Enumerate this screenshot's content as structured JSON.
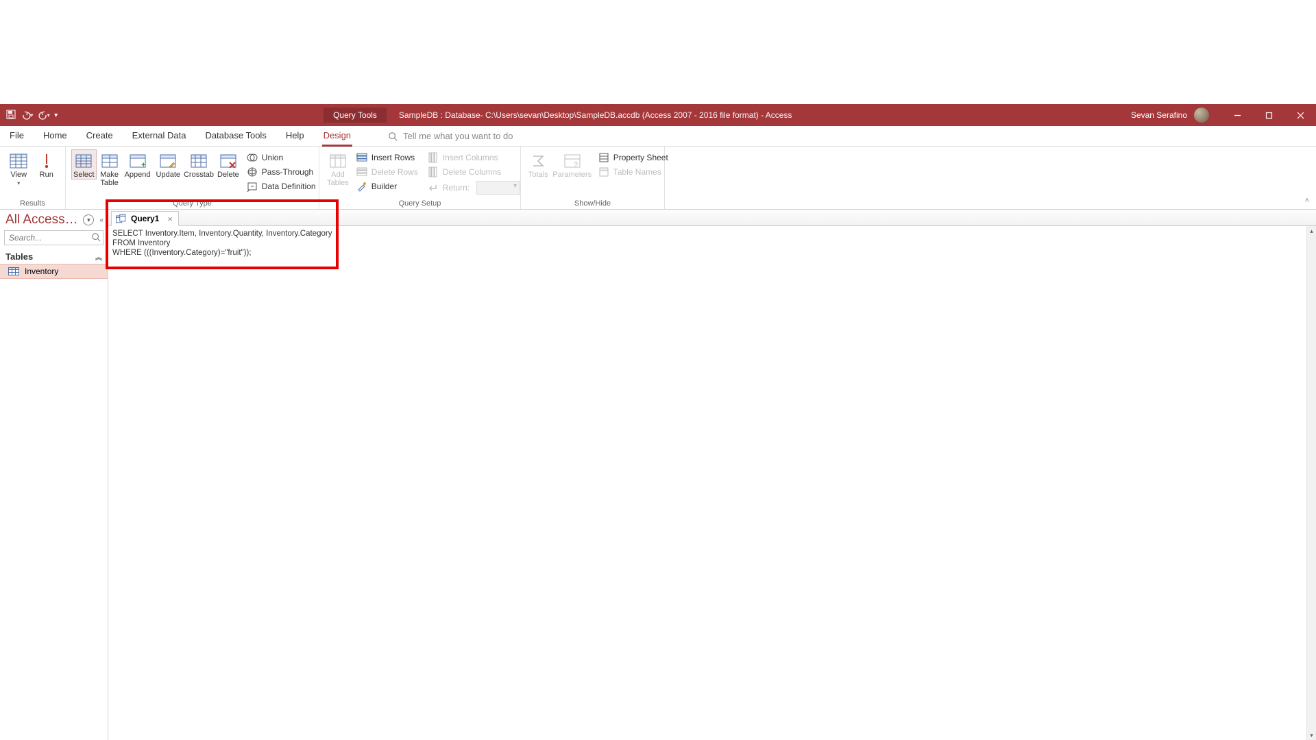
{
  "titlebar": {
    "contextual_tab": "Query Tools",
    "document_title": "SampleDB : Database- C:\\Users\\sevan\\Desktop\\SampleDB.accdb (Access 2007 - 2016 file format)  -  Access",
    "user_name": "Sevan Serafino"
  },
  "menubar": {
    "tabs": [
      "File",
      "Home",
      "Create",
      "External Data",
      "Database Tools",
      "Help",
      "Design"
    ],
    "active_tab_index": 6,
    "search_placeholder": "Tell me what you want to do"
  },
  "ribbon": {
    "groups": {
      "results": {
        "label": "Results",
        "buttons": {
          "view": "View",
          "run": "Run"
        }
      },
      "query_type": {
        "label": "Query Type",
        "buttons": {
          "select": "Select",
          "make_table_l1": "Make",
          "make_table_l2": "Table",
          "append": "Append",
          "update": "Update",
          "crosstab": "Crosstab",
          "delete": "Delete",
          "union": "Union",
          "pass_through": "Pass-Through",
          "data_definition": "Data Definition"
        }
      },
      "query_setup": {
        "label": "Query Setup",
        "buttons": {
          "add_tables_l1": "Add",
          "add_tables_l2": "Tables",
          "insert_rows": "Insert Rows",
          "delete_rows": "Delete Rows",
          "builder": "Builder",
          "insert_columns": "Insert Columns",
          "delete_columns": "Delete Columns",
          "return": "Return:"
        }
      },
      "show_hide": {
        "label": "Show/Hide",
        "buttons": {
          "totals": "Totals",
          "parameters": "Parameters",
          "property_sheet": "Property Sheet",
          "table_names": "Table Names"
        }
      }
    }
  },
  "navpane": {
    "title": "All Access …",
    "search_placeholder": "Search...",
    "section": "Tables",
    "items": [
      "Inventory"
    ]
  },
  "document": {
    "tab_name": "Query1",
    "sql": "SELECT Inventory.Item, Inventory.Quantity, Inventory.Category\nFROM Inventory\nWHERE (((Inventory.Category)=\"fruit\"));"
  }
}
